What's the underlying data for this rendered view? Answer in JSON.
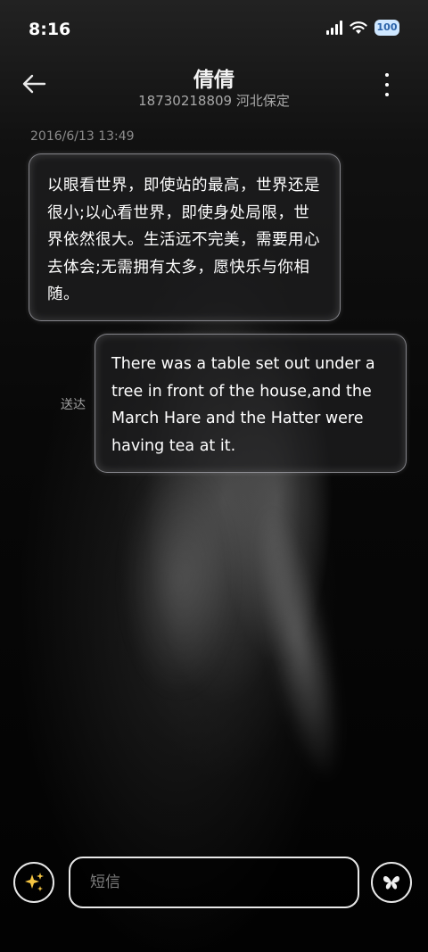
{
  "status_bar": {
    "time": "8:16",
    "battery_level": "100"
  },
  "header": {
    "contact_name": "倩倩",
    "contact_subtitle": "18730218809 河北保定"
  },
  "conversation": {
    "timestamp": "2016/6/13 13:49",
    "incoming_message": "以眼看世界，即使站的最高，世界还是很小;以心看世界，即使身处局限，世界依然很大。生活远不完美，需要用心去体会;无需拥有太多，愿快乐与你相随。",
    "outgoing_message": "There was a table set out under a tree in front of the house,and the March Hare and the Hatter were having tea at it.",
    "delivery_status": "送达"
  },
  "composer": {
    "placeholder": "短信"
  },
  "icons": {
    "back": "arrow-left-icon",
    "more": "more-vertical-icon",
    "sparkle": "sparkle-icon",
    "send": "butterfly-send-icon",
    "signal": "signal-icon",
    "wifi": "wifi-icon",
    "battery": "battery-icon"
  },
  "colors": {
    "background": "#050505",
    "bubble_border": "#dcdce6",
    "accent_battery": "#cfe7ff"
  }
}
